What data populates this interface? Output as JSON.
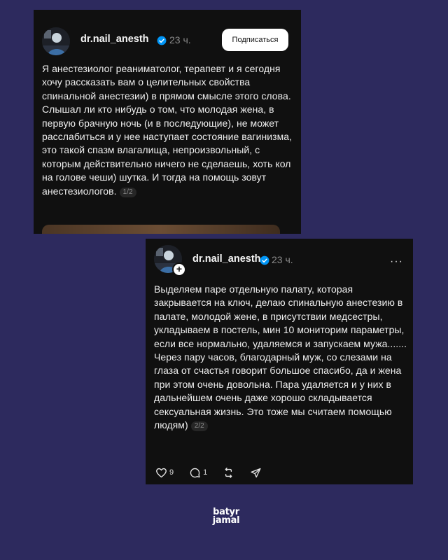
{
  "post1": {
    "username": "dr.nail_anesth",
    "time": "23 ч.",
    "subscribe_label": "Подписаться",
    "text": "Я анестезиолог реаниматолог, терапевт и я сегодня хочу рассказать вам о целительных свойства спинальной анестезии) в прямом смысле этого слова. Слышал ли кто нибудь о том, что молодая жена, в первую брачную ночь (и в последующие), не может расслабиться и у нее наступает состояние вагинизма, это такой спазм влагалища, непроизвольный, с которым действительно ничего не сделаешь, хоть кол на голове чеши) шутка. И тогда на помощь зовут анестезиологов.",
    "page_indicator": "1/2"
  },
  "post2": {
    "username": "dr.nail_anesth",
    "time": "23 ч.",
    "more_label": "···",
    "text": "Выделяем паре отдельную палату, которая закрывается на ключ, делаю спинальную анестезию в палате, молодой жене, в присутствии медсестры, укладываем в постель, мин 10 мониторим параметры, если все нормально, удаляемся и запускаем мужа....... Через пару часов, благодарный муж, со слезами на глаза от счастья говорит большое спасибо, да и жена при этом очень довольна. Пара удаляется и у них в дальнейшем очень даже хорошо складывается сексуальная жизнь. Это тоже мы считаем помощью людям)",
    "page_indicator": "2/2",
    "likes": "9",
    "comments": "1"
  },
  "logo": {
    "line1": "batyr",
    "line2": "jamal"
  },
  "colors": {
    "background": "#2d2a5e",
    "card": "#101010",
    "verified": "#0095f6"
  },
  "icons": {
    "verified": "verified-badge-icon",
    "like": "heart-icon",
    "comment": "comment-icon",
    "repost": "repost-icon",
    "share": "share-icon",
    "follow": "plus-icon"
  }
}
